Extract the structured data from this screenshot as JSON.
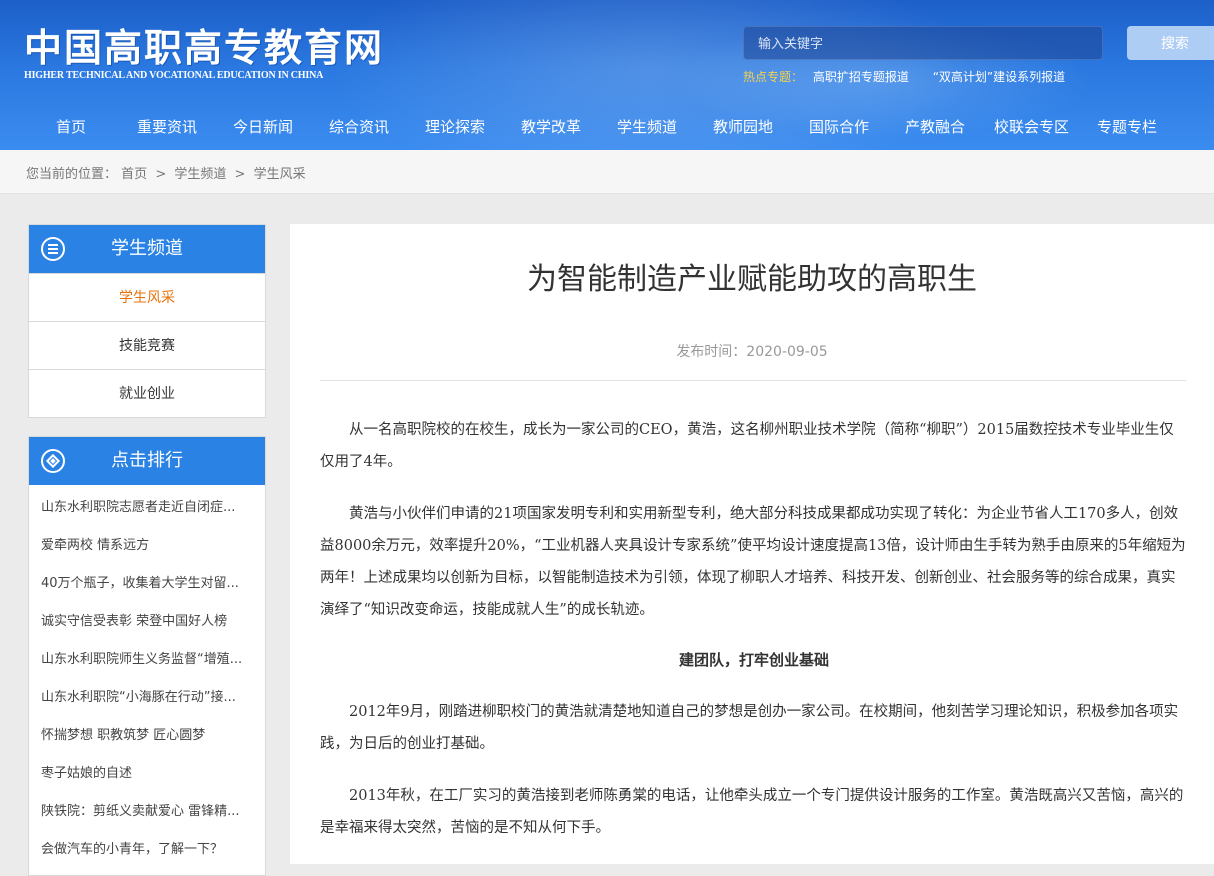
{
  "header": {
    "logo_cn": "中国高职高专教育网",
    "logo_en": "HIGHER TECHNICAL AND VOCATIONAL EDUCATION IN CHINA",
    "search_placeholder": "输入关键字",
    "search_button": "搜索",
    "hot_label": "热点专题：",
    "hot_links": [
      "高职扩招专题报道",
      "“双高计划”建设系列报道"
    ]
  },
  "nav": [
    "首页",
    "重要资讯",
    "今日新闻",
    "综合资讯",
    "理论探索",
    "教学改革",
    "学生频道",
    "教师园地",
    "国际合作",
    "产教融合",
    "校联会专区",
    "专题专栏"
  ],
  "breadcrumb": {
    "label": "您当前的位置：",
    "items": [
      "首页",
      "学生频道",
      "学生风采"
    ],
    "separator": ">"
  },
  "sidebar": {
    "category_title": "学生频道",
    "categories": [
      {
        "label": "学生风采",
        "active": true
      },
      {
        "label": "技能竞赛",
        "active": false
      },
      {
        "label": "就业创业",
        "active": false
      }
    ],
    "ranking_title": "点击排行",
    "ranking": [
      "山东水利职院志愿者走近自闭症...",
      "爱牵两校 情系远方",
      "40万个瓶子，收集着大学生对留...",
      "诚实守信受表彰 荣登中国好人榜",
      "山东水利职院师生义务监督“增殖...",
      "山东水利职院“小海豚在行动”接...",
      "怀揣梦想 职教筑梦 匠心圆梦",
      "枣子姑娘的自述",
      "陕铁院：剪纸义卖献爱心 雷锋精...",
      "会做汽车的小青年，了解一下？"
    ]
  },
  "article": {
    "title": "为智能制造产业赋能助攻的高职生",
    "publish": "发布时间：2020-09-05",
    "paragraphs_1": [
      "从一名高职院校的在校生，成长为一家公司的CEO，黄浩，这名柳州职业技术学院（简称“柳职”）2015届数控技术专业毕业生仅仅用了4年。",
      "黄浩与小伙伴们申请的21项国家发明专利和实用新型专利，绝大部分科技成果都成功实现了转化：为企业节省人工170多人，创效益8000余万元，效率提升20%，“工业机器人夹具设计专家系统”使平均设计速度提高13倍，设计师由生手转为熟手由原来的5年缩短为两年！上述成果均以创新为目标，以智能制造技术为引领，体现了柳职人才培养、科技开发、创新创业、社会服务等的综合成果，真实演绎了“知识改变命运，技能成就人生”的成长轨迹。"
    ],
    "subheading": "建团队，打牢创业基础",
    "paragraphs_2": [
      "2012年9月，刚踏进柳职校门的黄浩就清楚地知道自己的梦想是创办一家公司。在校期间，他刻苦学习理论知识，积极参加各项实践，为日后的创业打基础。",
      "2013年秋，在工厂实习的黄浩接到老师陈勇棠的电话，让他牵头成立一个专门提供设计服务的工作室。黄浩既高兴又苦恼，高兴的是幸福来得太突然，苦恼的是不知从何下手。"
    ]
  },
  "colors": {
    "header_blue": "#2a78e0",
    "panel_blue": "#2a82e4",
    "active_orange": "#e8730c",
    "hot_yellow": "#f8d24c"
  }
}
